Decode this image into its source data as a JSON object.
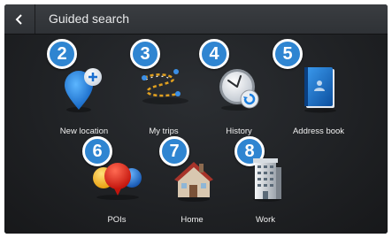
{
  "header": {
    "title": "Guided search",
    "back_icon": "chevron-left-icon"
  },
  "tiles": [
    {
      "label": "New location",
      "badge": "2",
      "icon": "pin-plus-icon"
    },
    {
      "label": "My trips",
      "badge": "3",
      "icon": "route-icon"
    },
    {
      "label": "History",
      "badge": "4",
      "icon": "clock-history-icon"
    },
    {
      "label": "Address book",
      "badge": "5",
      "icon": "address-book-icon"
    },
    {
      "label": "POIs",
      "badge": "6",
      "icon": "poi-balloons-icon"
    },
    {
      "label": "Home",
      "badge": "7",
      "icon": "house-icon"
    },
    {
      "label": "Work",
      "badge": "8",
      "icon": "office-building-icon"
    }
  ],
  "colors": {
    "badge": "#2f85d1",
    "accent_blue": "#1a7fe0",
    "background": "#1c1e21"
  }
}
